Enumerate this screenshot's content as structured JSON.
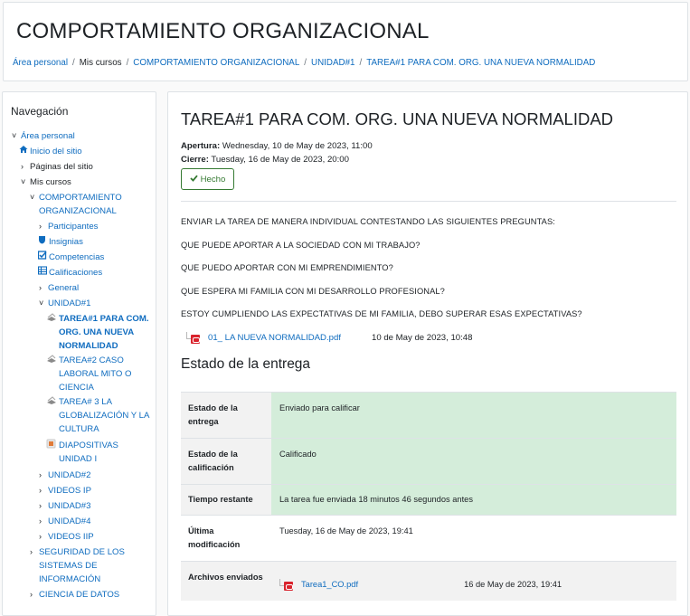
{
  "header": {
    "course_title": "COMPORTAMIENTO ORGANIZACIONAL",
    "breadcrumb": [
      {
        "label": "Área personal",
        "link": true
      },
      {
        "label": "Mis cursos",
        "link": false
      },
      {
        "label": "COMPORTAMIENTO ORGANIZACIONAL",
        "link": true
      },
      {
        "label": "UNIDAD#1",
        "link": true
      },
      {
        "label": "TAREA#1 PARA COM. ORG. UNA NUEVA NORMALIDAD",
        "link": true
      }
    ]
  },
  "navigation": {
    "title": "Navegación",
    "items": [
      {
        "label": "Área personal",
        "arrow": "˅",
        "icon": "",
        "blue": true,
        "bold": false
      },
      {
        "label": "Inicio del sitio",
        "arrow": "",
        "icon": "home-icon",
        "blue": true,
        "bold": false
      },
      {
        "label": "Páginas del sitio",
        "arrow": "›",
        "icon": "",
        "blue": false,
        "bold": false
      },
      {
        "label": "Mis cursos",
        "arrow": "˅",
        "icon": "",
        "blue": false,
        "bold": false
      },
      {
        "label": "COMPORTAMIENTO ORGANIZACIONAL",
        "arrow": "˅",
        "icon": "",
        "blue": true,
        "bold": false
      },
      {
        "label": "Participantes",
        "arrow": "›",
        "icon": "",
        "blue": true,
        "bold": false
      },
      {
        "label": "Insignias",
        "arrow": "",
        "icon": "shield-icon",
        "blue": true,
        "bold": false
      },
      {
        "label": "Competencias",
        "arrow": "",
        "icon": "checkbox-icon",
        "blue": true,
        "bold": false
      },
      {
        "label": "Calificaciones",
        "arrow": "",
        "icon": "table-icon",
        "blue": true,
        "bold": false
      },
      {
        "label": "General",
        "arrow": "›",
        "icon": "",
        "blue": true,
        "bold": false
      },
      {
        "label": "UNIDAD#1",
        "arrow": "˅",
        "icon": "",
        "blue": true,
        "bold": false
      },
      {
        "label": "TAREA#1 PARA COM. ORG. UNA NUEVA NORMALIDAD",
        "arrow": "",
        "icon": "assignment-icon",
        "blue": true,
        "bold": true
      },
      {
        "label": "TAREA#2 CASO LABORAL MITO O CIENCIA",
        "arrow": "",
        "icon": "assignment-icon",
        "blue": true,
        "bold": false
      },
      {
        "label": "TAREA# 3 LA GLOBALIZACIÓN Y LA CULTURA",
        "arrow": "",
        "icon": "assignment-icon",
        "blue": true,
        "bold": false
      },
      {
        "label": "DIAPOSITIVAS UNIDAD I",
        "arrow": "",
        "icon": "slides-icon",
        "blue": true,
        "bold": false
      },
      {
        "label": "UNIDAD#2",
        "arrow": "›",
        "icon": "",
        "blue": true,
        "bold": false
      },
      {
        "label": "VIDEOS IP",
        "arrow": "›",
        "icon": "",
        "blue": true,
        "bold": false
      },
      {
        "label": "UNIDAD#3",
        "arrow": "›",
        "icon": "",
        "blue": true,
        "bold": false
      },
      {
        "label": "UNIDAD#4",
        "arrow": "›",
        "icon": "",
        "blue": true,
        "bold": false
      },
      {
        "label": "VIDEOS IIP",
        "arrow": "›",
        "icon": "",
        "blue": true,
        "bold": false
      },
      {
        "label": "SEGURIDAD DE LOS SISTEMAS DE INFORMACIÓN",
        "arrow": "›",
        "icon": "",
        "blue": true,
        "bold": false
      },
      {
        "label": "CIENCIA DE DATOS",
        "arrow": "›",
        "icon": "",
        "blue": true,
        "bold": false
      }
    ]
  },
  "assignment": {
    "title": "TAREA#1 PARA COM. ORG. UNA NUEVA NORMALIDAD",
    "opening_label": "Apertura:",
    "opening_value": " Wednesday, 10 de May de 2023, 11:00",
    "closing_label": "Cierre:",
    "closing_value": " Tuesday, 16 de May de 2023, 20:00",
    "done_label": "Hecho",
    "instructions": [
      "ENVIAR LA TAREA DE MANERA INDIVIDUAL CONTESTANDO LAS SIGUIENTES PREGUNTAS:",
      "QUE PUEDE APORTAR A LA SOCIEDAD CON MI TRABAJO?",
      "QUE PUEDO APORTAR CON MI EMPRENDIMIENTO?",
      "QUE ESPERA MI FAMILIA CON MI DESARROLLO PROFESIONAL?",
      "ESTOY CUMPLIENDO LAS EXPECTATIVAS DE MI FAMILIA, DEBO SUPERAR ESAS EXPECTATIVAS?"
    ],
    "attachment_name": "01_ LA NUEVA NORMALIDAD.pdf",
    "attachment_date": "10 de May de 2023, 10:48"
  },
  "submission": {
    "heading": "Estado de la entrega",
    "rows": {
      "status_label": "Estado de la entrega",
      "status_value": "Enviado para calificar",
      "grading_label": "Estado de la calificación",
      "grading_value": "Calificado",
      "time_label": "Tiempo restante",
      "time_value": "La tarea fue enviada 18 minutos 46 segundos antes",
      "modified_label": "Última modificación",
      "modified_value": "Tuesday, 16 de May de 2023, 19:41",
      "files_label": "Archivos enviados",
      "file_name": "Tarea1_CO.pdf",
      "file_date": "16 de May de 2023, 19:41"
    }
  },
  "colors": {
    "link": "#0f6cbf",
    "success_bg": "#d4edda",
    "done_green": "#357a32",
    "pdf_red": "#d9232d"
  }
}
